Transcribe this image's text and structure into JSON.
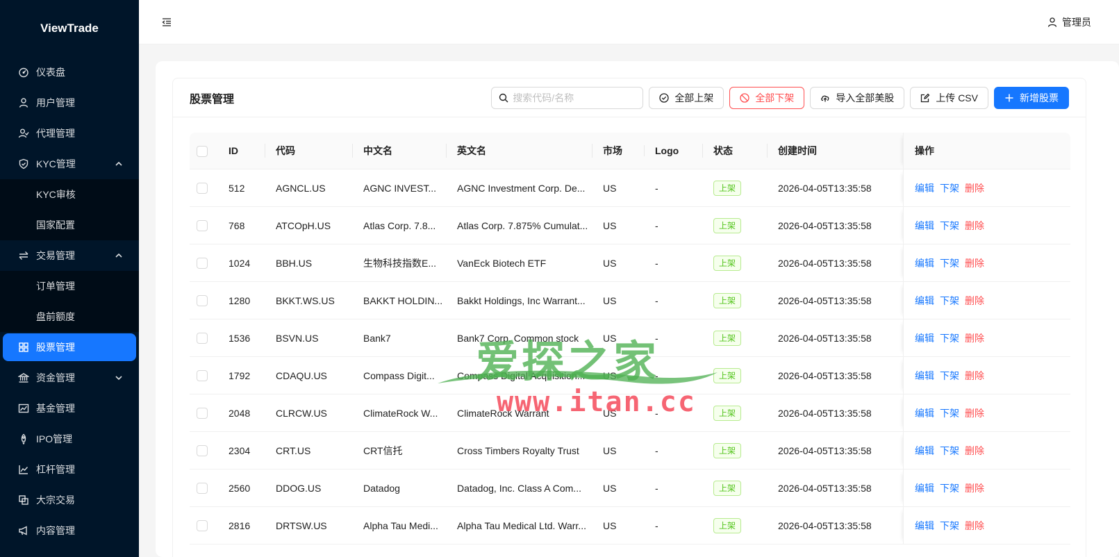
{
  "sidebar": {
    "brand": "ViewTrade",
    "items": [
      {
        "label": "仪表盘",
        "icon": "dashboard-icon"
      },
      {
        "label": "用户管理",
        "icon": "user-icon"
      },
      {
        "label": "代理管理",
        "icon": "agent-icon"
      },
      {
        "label": "KYC管理",
        "icon": "shield-check-icon",
        "expanded": true,
        "children": [
          {
            "label": "KYC审核"
          },
          {
            "label": "国家配置"
          }
        ]
      },
      {
        "label": "交易管理",
        "icon": "swap-icon",
        "expanded": true,
        "children": [
          {
            "label": "订单管理"
          },
          {
            "label": "盘前额度"
          }
        ]
      },
      {
        "label": "股票管理",
        "icon": "appstore-icon",
        "active": true
      },
      {
        "label": "资金管理",
        "icon": "bank-icon",
        "expanded": false
      },
      {
        "label": "基金管理",
        "icon": "fund-icon"
      },
      {
        "label": "IPO管理",
        "icon": "rocket-icon"
      },
      {
        "label": "杠杆管理",
        "icon": "line-chart-icon"
      },
      {
        "label": "大宗交易",
        "icon": "block-icon"
      },
      {
        "label": "内容管理",
        "icon": "notification-icon"
      }
    ]
  },
  "header": {
    "user_label": "管理员"
  },
  "page": {
    "title": "股票管理",
    "search_placeholder": "搜索代码/名称",
    "buttons": {
      "list_all": "全部上架",
      "delist_all": "全部下架",
      "import_all": "导入全部美股",
      "upload_csv": "上传 CSV",
      "add_stock": "新增股票"
    }
  },
  "table": {
    "columns": [
      "ID",
      "代码",
      "中文名",
      "英文名",
      "市场",
      "Logo",
      "状态",
      "创建时间",
      "操作"
    ],
    "ops": {
      "edit": "编辑",
      "delist": "下架",
      "delete": "删除"
    },
    "rows": [
      {
        "id": "512",
        "code": "AGNCL.US",
        "cn": "AGNC INVEST...",
        "en": "AGNC Investment Corp. De...",
        "market": "US",
        "logo": "-",
        "status": "上架",
        "time": "2026-04-05T13:35:58"
      },
      {
        "id": "768",
        "code": "ATCOpH.US",
        "cn": "Atlas Corp. 7.8...",
        "en": "Atlas Corp. 7.875% Cumulat...",
        "market": "US",
        "logo": "-",
        "status": "上架",
        "time": "2026-04-05T13:35:58"
      },
      {
        "id": "1024",
        "code": "BBH.US",
        "cn": "生物科技指数E...",
        "en": "VanEck Biotech ETF",
        "market": "US",
        "logo": "-",
        "status": "上架",
        "time": "2026-04-05T13:35:58"
      },
      {
        "id": "1280",
        "code": "BKKT.WS.US",
        "cn": "BAKKT HOLDIN...",
        "en": "Bakkt Holdings, Inc Warrant...",
        "market": "US",
        "logo": "-",
        "status": "上架",
        "time": "2026-04-05T13:35:58"
      },
      {
        "id": "1536",
        "code": "BSVN.US",
        "cn": "Bank7",
        "en": "Bank7 Corp. Common stock",
        "market": "US",
        "logo": "-",
        "status": "上架",
        "time": "2026-04-05T13:35:58"
      },
      {
        "id": "1792",
        "code": "CDAQU.US",
        "cn": "Compass Digit...",
        "en": "Compass Digital Acquisition...",
        "market": "US",
        "logo": "-",
        "status": "上架",
        "time": "2026-04-05T13:35:58"
      },
      {
        "id": "2048",
        "code": "CLRCW.US",
        "cn": "ClimateRock W...",
        "en": "ClimateRock Warrant",
        "market": "US",
        "logo": "-",
        "status": "上架",
        "time": "2026-04-05T13:35:58"
      },
      {
        "id": "2304",
        "code": "CRT.US",
        "cn": "CRT信托",
        "en": "Cross Timbers Royalty Trust",
        "market": "US",
        "logo": "-",
        "status": "上架",
        "time": "2026-04-05T13:35:58"
      },
      {
        "id": "2560",
        "code": "DDOG.US",
        "cn": "Datadog",
        "en": "Datadog, Inc. Class A Com...",
        "market": "US",
        "logo": "-",
        "status": "上架",
        "time": "2026-04-05T13:35:58"
      },
      {
        "id": "2816",
        "code": "DRTSW.US",
        "cn": "Alpha Tau Medi...",
        "en": "Alpha Tau Medical Ltd. Warr...",
        "market": "US",
        "logo": "-",
        "status": "上架",
        "time": "2026-04-05T13:35:58"
      }
    ]
  },
  "watermark": {
    "title": "爱探之家",
    "url": "www.itan.cc"
  },
  "colors": {
    "primary": "#1677ff",
    "danger": "#ff4d4f",
    "success": "#52c41a",
    "sidebar": "#001529"
  }
}
